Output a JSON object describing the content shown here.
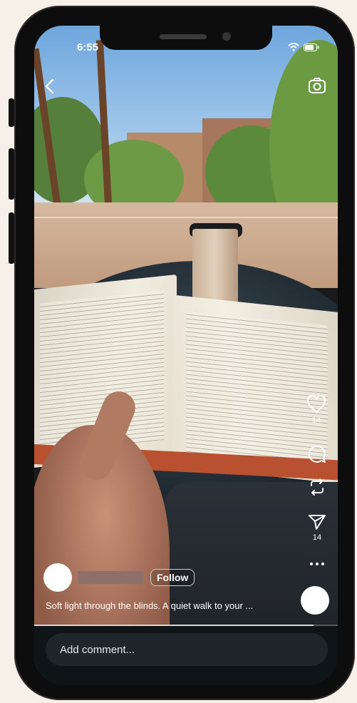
{
  "status_bar": {
    "time": "6:55"
  },
  "post": {
    "caption": "Soft light through the blinds. A quiet walk to your ...",
    "follow_label": "Follow",
    "progress": 0.92
  },
  "actions": {
    "like_count": "14",
    "share_count": "14"
  },
  "comment": {
    "placeholder": "Add comment..."
  },
  "icons": {
    "back": "chevron-left-icon",
    "camera": "camera-icon",
    "like": "heart-icon",
    "comment": "comment-icon",
    "repost": "repost-icon",
    "share": "send-icon",
    "more": "more-icon"
  }
}
